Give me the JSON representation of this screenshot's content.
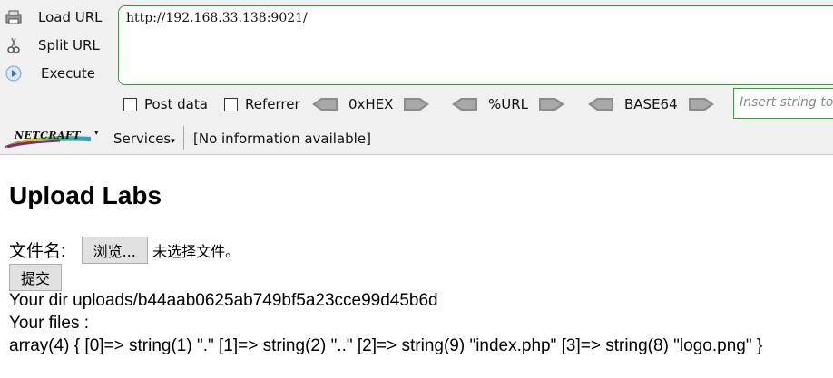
{
  "toolbar": {
    "load_url": "Load URL",
    "split_url": "Split URL",
    "execute": "Execute",
    "url": "http://192.168.33.138:9021/",
    "post_data": "Post data",
    "referrer": "Referrer",
    "hex": "0xHEX",
    "urlenc": "%URL",
    "base64": "BASE64",
    "insert_placeholder": "Insert string to"
  },
  "netcraft": {
    "logo": "NETCRAFT",
    "services": "Services",
    "info": "[No information available]"
  },
  "page": {
    "title": "Upload Labs",
    "file_label": "文件名:",
    "browse": "浏览...",
    "no_file": "未选择文件。",
    "submit": "提交",
    "dir_line": "Your dir uploads/b44aab0625ab749bf5a23cce99d45b6d",
    "files_label": "Your files :",
    "files_dump": "array(4) { [0]=> string(1) \".\" [1]=> string(2) \"..\" [2]=> string(9) \"index.php\" [3]=> string(8) \"logo.png\" }"
  },
  "colors": {
    "accent_green": "#2aa42a",
    "toolbar_bg": "#f0f0f0"
  }
}
